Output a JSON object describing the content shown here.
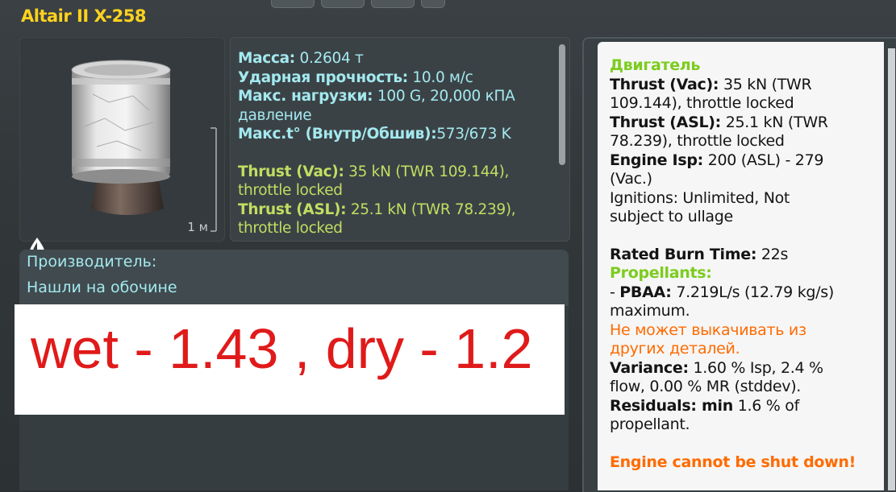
{
  "title": "Altair II X-258",
  "preview": {
    "scale": "1 м"
  },
  "stats": {
    "mass_label": "Масса:",
    "mass_value": "0.2604 т",
    "impact_label": "Ударная прочность:",
    "impact_value": "10.0 м/с",
    "maxload_label": "Макс. нагрузки:",
    "maxload_value": "100 G, 20,000 кПА",
    "maxload_value2": "давление",
    "maxtemp_label": "Макс.t° (Внутр/Обшив):",
    "maxtemp_value": "573/673 K",
    "thrust_vac_label": "Thrust (Vac):",
    "thrust_vac_value": "35 kN (TWR 109.144),",
    "thrust_vac_value2": "throttle locked",
    "thrust_asl_label": "Thrust (ASL):",
    "thrust_asl_value": "25.1 kN (TWR 78.239),",
    "thrust_asl_value2": "throttle locked"
  },
  "manufacturer": {
    "label": "Производитель:",
    "value": "Нашли на обочине"
  },
  "note": "wet - 1.43 , dry - 1.2",
  "engine": {
    "header": "Двигатель",
    "thrust_vac_label": "Thrust (Vac):",
    "thrust_vac_value": "35 kN (TWR",
    "thrust_vac_value2": "109.144), throttle locked",
    "thrust_asl_label": "Thrust (ASL):",
    "thrust_asl_value": "25.1 kN (TWR",
    "thrust_asl_value2": "78.239), throttle locked",
    "isp_label": "Engine Isp:",
    "isp_value": "200 (ASL) - 279",
    "isp_value2": "(Vac.)",
    "ignitions": "Ignitions: Unlimited, Not",
    "ignitions2": "subject to ullage",
    "burn_label": "Rated Burn Time:",
    "burn_value": "22s",
    "propellants_label": "Propellants:",
    "pbaa_prefix": "- ",
    "pbaa_label": "PBAA:",
    "pbaa_value": "7.219L/s (12.79 kg/s)",
    "pbaa_value2": "maximum.",
    "no_pump": "Не может выкачивать из",
    "no_pump2": "других деталей.",
    "variance_label": "Variance:",
    "variance_value": "1.60 % Isp, 2.4 %",
    "variance_value2": "flow, 0.00 % MR (stddev).",
    "residuals_label": "Residuals: min",
    "residuals_value": "1.6 % of",
    "residuals_value2": "propellant.",
    "warning": "Engine cannot be shut down!"
  },
  "colors": {
    "title": "#ffd21e",
    "stats_text": "#a3e9ef",
    "thrust_text": "#c1de61",
    "note_text": "#e01a1a",
    "engine_header": "#7ccc1e",
    "warning": "#ff6b00"
  }
}
